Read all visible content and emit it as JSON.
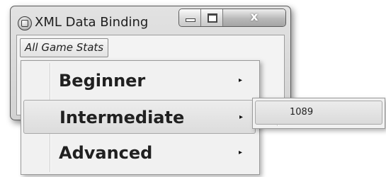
{
  "window": {
    "title": "XML Data Binding",
    "icon": "app-icon",
    "caption_buttons": {
      "minimize": "minimize-icon",
      "maximize": "maximize-icon",
      "close_label": "x"
    }
  },
  "menu_bar": {
    "items": [
      {
        "label": "All Game Stats"
      }
    ]
  },
  "dropdown": {
    "items": [
      {
        "label": "Beginner",
        "has_submenu": true,
        "highlighted": false
      },
      {
        "label": "Intermediate",
        "has_submenu": true,
        "highlighted": true
      },
      {
        "label": "Advanced",
        "has_submenu": true,
        "highlighted": false
      }
    ],
    "submenu_arrow": "▸"
  },
  "submenu": {
    "items": [
      {
        "label": "1089"
      }
    ]
  }
}
